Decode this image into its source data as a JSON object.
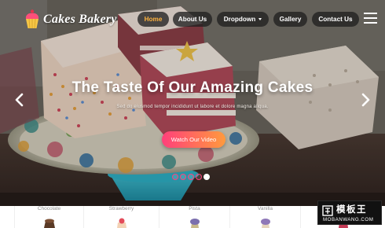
{
  "brand": {
    "name": "Cakes Bakery",
    "logo_icon": "cupcake-icon"
  },
  "nav": {
    "items": [
      {
        "label": "Home",
        "active": true
      },
      {
        "label": "About Us",
        "active": false
      },
      {
        "label": "Dropdown",
        "active": false,
        "has_caret": true
      },
      {
        "label": "Gallery",
        "active": false
      },
      {
        "label": "Contact Us",
        "active": false
      }
    ],
    "menu_icon": "hamburger-menu-icon"
  },
  "hero": {
    "title": "The Taste Of Our Amazing Cakes",
    "subtitle": "Sed do eiusmod tempor incididunt ut labore et dolore magna aliqua.",
    "cta_label": "Watch Our Video",
    "prev_icon": "chevron-left-icon",
    "next_icon": "chevron-right-icon",
    "slide_count": 5,
    "active_slide": 5
  },
  "categories": [
    {
      "label": "Chocolate",
      "icon": "chocolate-cake-icon",
      "color": "#5a3a26"
    },
    {
      "label": "Strawberry",
      "icon": "strawberry-cake-icon",
      "color": "#e34b5a"
    },
    {
      "label": "Pista",
      "icon": "pista-cupcake-icon",
      "color": "#7b6fae"
    },
    {
      "label": "Vanilla",
      "icon": "vanilla-cupcake-icon",
      "color": "#8f78b8"
    },
    {
      "label": "",
      "icon": "cake-icon",
      "color": "#c33a55"
    }
  ],
  "watermark": {
    "title": "模板王",
    "url": "MOBANWANG.COM"
  },
  "colors": {
    "accent": "#ffb23f",
    "cta_start": "#ff3f7b",
    "cta_end": "#ff9a3d",
    "nav_bg": "#202020"
  }
}
